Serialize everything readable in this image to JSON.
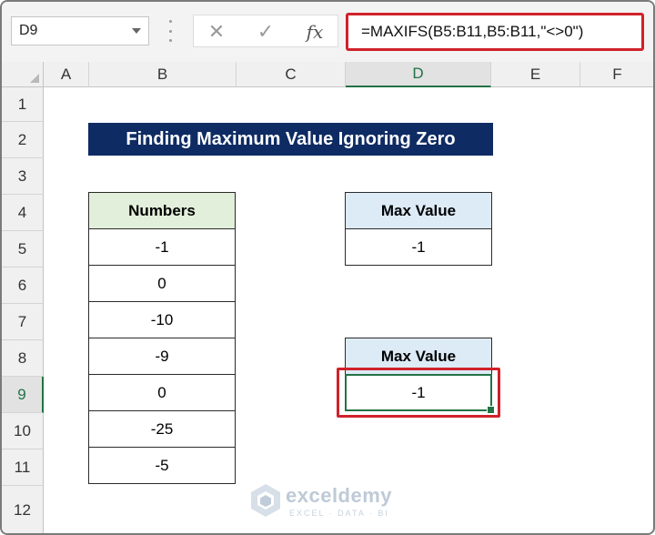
{
  "formula_bar": {
    "name_box": "D9",
    "cancel_glyph": "✕",
    "enter_glyph": "✓",
    "fx_label": "fx",
    "formula": "=MAXIFS(B5:B11,B5:B11,\"<>0\")"
  },
  "columns": [
    "A",
    "B",
    "C",
    "D",
    "E",
    "F"
  ],
  "rows": [
    "1",
    "2",
    "3",
    "4",
    "5",
    "6",
    "7",
    "8",
    "9",
    "10",
    "11",
    "12"
  ],
  "sheet": {
    "title": "Finding Maximum Value Ignoring Zero",
    "numbers_header": "Numbers",
    "numbers": [
      "-1",
      "0",
      "-10",
      "-9",
      "0",
      "-25",
      "-5"
    ],
    "max1_header": "Max Value",
    "max1_value": "-1",
    "max2_header": "Max Value",
    "max2_value": "-1"
  },
  "watermark": {
    "brand": "exceldemy",
    "tagline": "EXCEL · DATA · BI"
  },
  "colors": {
    "title_bg": "#0e2b63",
    "numbers_header_bg": "#e2efda",
    "max_header_bg": "#ddebf7",
    "highlight": "#d0212a",
    "selection": "#217346"
  }
}
